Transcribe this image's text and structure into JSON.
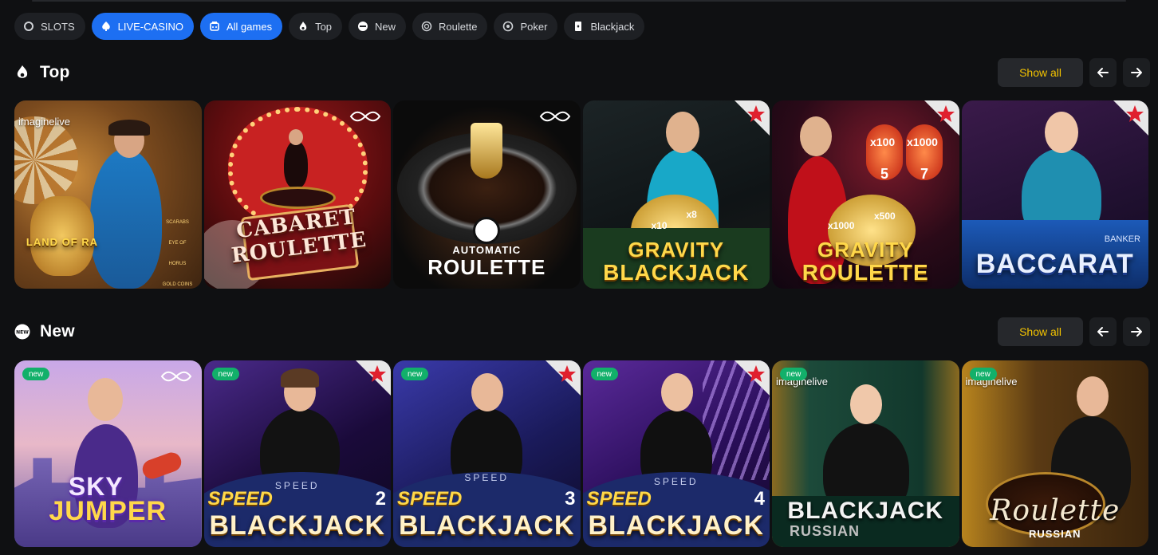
{
  "filters": [
    {
      "label": "SLOTS",
      "icon": "slots-icon",
      "active": false
    },
    {
      "label": "LIVE-CASINO",
      "icon": "live-casino-icon",
      "active": true
    },
    {
      "label": "All games",
      "icon": "all-games-icon",
      "active": true
    },
    {
      "label": "Top",
      "icon": "top-icon",
      "active": false
    },
    {
      "label": "New",
      "icon": "new-icon",
      "active": false
    },
    {
      "label": "Roulette",
      "icon": "roulette-icon",
      "active": false
    },
    {
      "label": "Poker",
      "icon": "poker-icon",
      "active": false
    },
    {
      "label": "Blackjack",
      "icon": "blackjack-icon",
      "active": false
    }
  ],
  "sections": {
    "top": {
      "title": "Top",
      "icon": "fire-icon",
      "show_all": "Show all",
      "games": [
        {
          "title": "LAND OF RA",
          "provider_text": "imaginelive",
          "side_labels": [
            "SCARABS",
            "EYE OF HORUS",
            "GOLD COINS"
          ]
        },
        {
          "title": "CABARET ROULETTE"
        },
        {
          "title_small": "AUTOMATIC",
          "title": "ROULETTE"
        },
        {
          "title": "GRAVITY",
          "subtitle": "BLACKJACK",
          "multipliers": [
            "x10",
            "x8"
          ]
        },
        {
          "title": "GRAVITY",
          "subtitle": "ROULETTE",
          "multipliers": [
            "x100",
            "x1000",
            "x1000",
            "x500"
          ],
          "numbers": [
            "5",
            "7"
          ]
        },
        {
          "title": "BACCARAT",
          "table_label": "BANKER"
        }
      ]
    },
    "new": {
      "title": "New",
      "icon": "new-badge-icon",
      "show_all": "Show all",
      "badge": "new",
      "games": [
        {
          "title": "SKY",
          "subtitle": "JUMPER"
        },
        {
          "title": "SPEED",
          "subtitle": "BLACKJACK",
          "number": "2",
          "table_label": "SPEED"
        },
        {
          "title": "SPEED",
          "subtitle": "BLACKJACK",
          "number": "3",
          "table_label": "SPEED"
        },
        {
          "title": "SPEED",
          "subtitle": "BLACKJACK",
          "number": "4",
          "table_label": "SPEED"
        },
        {
          "title": "BLACKJACK",
          "subtitle": "RUSSIAN",
          "provider_text": "imaginelive"
        },
        {
          "title": "Roulette",
          "subtitle": "RUSSIAN",
          "provider_text": "imaginelive"
        }
      ]
    }
  },
  "colors": {
    "accent": "#1d6ff2",
    "show_all_text": "#f2c200",
    "new_badge": "#12b06a",
    "page_bg": "#0f1012"
  }
}
